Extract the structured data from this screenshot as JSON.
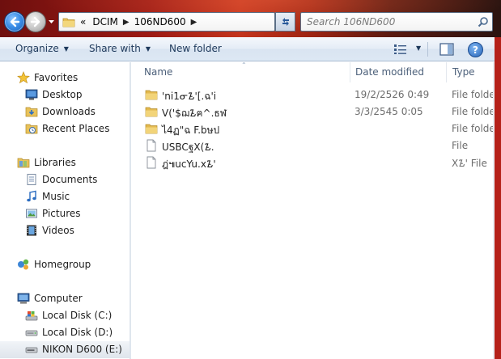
{
  "address_bar": {
    "overflow_chevron": "«",
    "segments": [
      "DCIM",
      "106ND600"
    ]
  },
  "search": {
    "placeholder": "Search 106ND600"
  },
  "toolbar": {
    "organize_label": "Organize",
    "share_label": "Share with",
    "new_folder_label": "New folder"
  },
  "sidebar": {
    "favorites": {
      "label": "Favorites",
      "items": [
        {
          "label": "Desktop",
          "icon": "desktop-icon"
        },
        {
          "label": "Downloads",
          "icon": "downloads-icon"
        },
        {
          "label": "Recent Places",
          "icon": "recent-places-icon"
        }
      ]
    },
    "libraries": {
      "label": "Libraries",
      "items": [
        {
          "label": "Documents",
          "icon": "documents-icon"
        },
        {
          "label": "Music",
          "icon": "music-icon"
        },
        {
          "label": "Pictures",
          "icon": "pictures-icon"
        },
        {
          "label": "Videos",
          "icon": "videos-icon"
        }
      ]
    },
    "homegroup": {
      "label": "Homegroup"
    },
    "computer": {
      "label": "Computer",
      "items": [
        {
          "label": "Local Disk (C:)",
          "icon": "local-disk-c-icon"
        },
        {
          "label": "Local Disk (D:)",
          "icon": "local-disk-d-icon"
        },
        {
          "label": "NIKON D600 (E:)",
          "icon": "removable-drive-icon",
          "selected": true
        }
      ]
    }
  },
  "columns": {
    "name": "Name",
    "date_modified": "Date modified",
    "type": "Type"
  },
  "files": [
    {
      "name": "'ni1ᓂ᮲'[.ฉ'i",
      "date": "19/2/2526 0:49",
      "type": "File folder",
      "icon": "folder-icon"
    },
    {
      "name": "V('$ฌ᮲ฅ^.ธฬ",
      "date": "3/3/2545 0:05",
      "type": "File folder",
      "icon": "folder-icon"
    },
    {
      "name": "ไ4ฏ\"ฉ F.bษป",
      "date": "",
      "type": "File folder",
      "icon": "folder-icon"
    },
    {
      "name": "USBCฐX(᮲.",
      "date": "",
      "type": "File",
      "icon": "file-icon"
    },
    {
      "name": "ฎ่๚ucYu.x᮲'",
      "date": "",
      "type": "X᮲' File",
      "icon": "file-icon"
    }
  ],
  "colors": {
    "title_bar": "#b5211a",
    "toolbar_text": "#1e395b",
    "header_text": "#4c607a",
    "secondary_text": "#6d6d6d"
  }
}
